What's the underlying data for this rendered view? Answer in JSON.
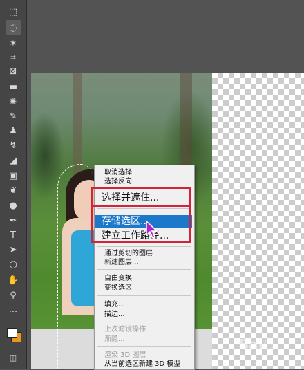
{
  "toolbar": {
    "tools": [
      {
        "name": "rect-marquee-icon",
        "glyph": "⬚"
      },
      {
        "name": "lasso-icon",
        "glyph": "◌"
      },
      {
        "name": "magic-wand-icon",
        "glyph": "✶"
      },
      {
        "name": "crop-icon",
        "glyph": "⌗"
      },
      {
        "name": "frame-icon",
        "glyph": "⊠"
      },
      {
        "name": "eyedropper-icon",
        "glyph": "▬"
      },
      {
        "name": "spot-healing-icon",
        "glyph": "✺"
      },
      {
        "name": "brush-icon",
        "glyph": "✎"
      },
      {
        "name": "clone-stamp-icon",
        "glyph": "♟"
      },
      {
        "name": "history-brush-icon",
        "glyph": "↯"
      },
      {
        "name": "eraser-icon",
        "glyph": "◢"
      },
      {
        "name": "gradient-icon",
        "glyph": "▣"
      },
      {
        "name": "blur-icon",
        "glyph": "❦"
      },
      {
        "name": "dodge-icon",
        "glyph": "●"
      },
      {
        "name": "pen-icon",
        "glyph": "✒"
      },
      {
        "name": "type-icon",
        "glyph": "T"
      },
      {
        "name": "path-select-icon",
        "glyph": "➤"
      },
      {
        "name": "shape-icon",
        "glyph": "⬡"
      },
      {
        "name": "hand-icon",
        "glyph": "✋"
      },
      {
        "name": "zoom-icon",
        "glyph": "⚲"
      },
      {
        "name": "more-tools-icon",
        "glyph": "···"
      }
    ],
    "foreground_color": "#ffffff",
    "background_color": "#e8961e"
  },
  "context_menu": {
    "items": [
      {
        "label": "取消选择",
        "enabled": true
      },
      {
        "label": "选择反向",
        "enabled": true
      },
      {
        "label": "选择并遮住...",
        "enabled": true,
        "large": true
      },
      {
        "label": "存储选区...",
        "enabled": true,
        "large": true,
        "highlighted": true
      },
      {
        "label": "建立工作路径...",
        "enabled": true,
        "large": true
      },
      {
        "label": "通过剪切的图层",
        "enabled": true
      },
      {
        "label": "新建图层...",
        "enabled": true
      },
      {
        "label": "自由变换",
        "enabled": true
      },
      {
        "label": "变换选区",
        "enabled": true
      },
      {
        "label": "填充...",
        "enabled": true
      },
      {
        "label": "描边...",
        "enabled": true
      },
      {
        "label": "上次滤镜操作",
        "enabled": false
      },
      {
        "label": "渐隐...",
        "enabled": false
      },
      {
        "label": "渲染 3D 图层",
        "enabled": false
      },
      {
        "label": "从当前选区新建 3D 模型",
        "enabled": true
      }
    ]
  },
  "colors": {
    "highlight": "#1c78c9",
    "annotation_box": "#d1243a"
  }
}
